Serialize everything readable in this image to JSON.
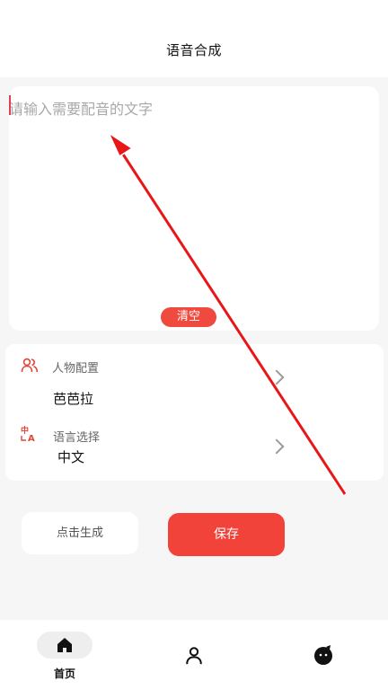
{
  "header": {
    "title": "语音合成"
  },
  "editor": {
    "placeholder": "请输入需要配音的文字",
    "value": "",
    "clear_label": "清空"
  },
  "config": {
    "character": {
      "label": "人物配置",
      "value": "芭芭拉",
      "icon": "people-icon"
    },
    "language": {
      "label": "语言选择",
      "value": "中文",
      "icon": "translate-icon"
    }
  },
  "actions": {
    "generate_label": "点击生成",
    "save_label": "保存"
  },
  "tabbar": {
    "items": [
      {
        "label": "首页",
        "icon": "home-icon",
        "active": true
      },
      {
        "label": "",
        "icon": "person-icon",
        "active": false
      },
      {
        "label": "",
        "icon": "mascot-icon",
        "active": false
      }
    ]
  },
  "colors": {
    "accent": "#f2433a",
    "background": "#f6f6f6",
    "card": "#ffffff"
  }
}
